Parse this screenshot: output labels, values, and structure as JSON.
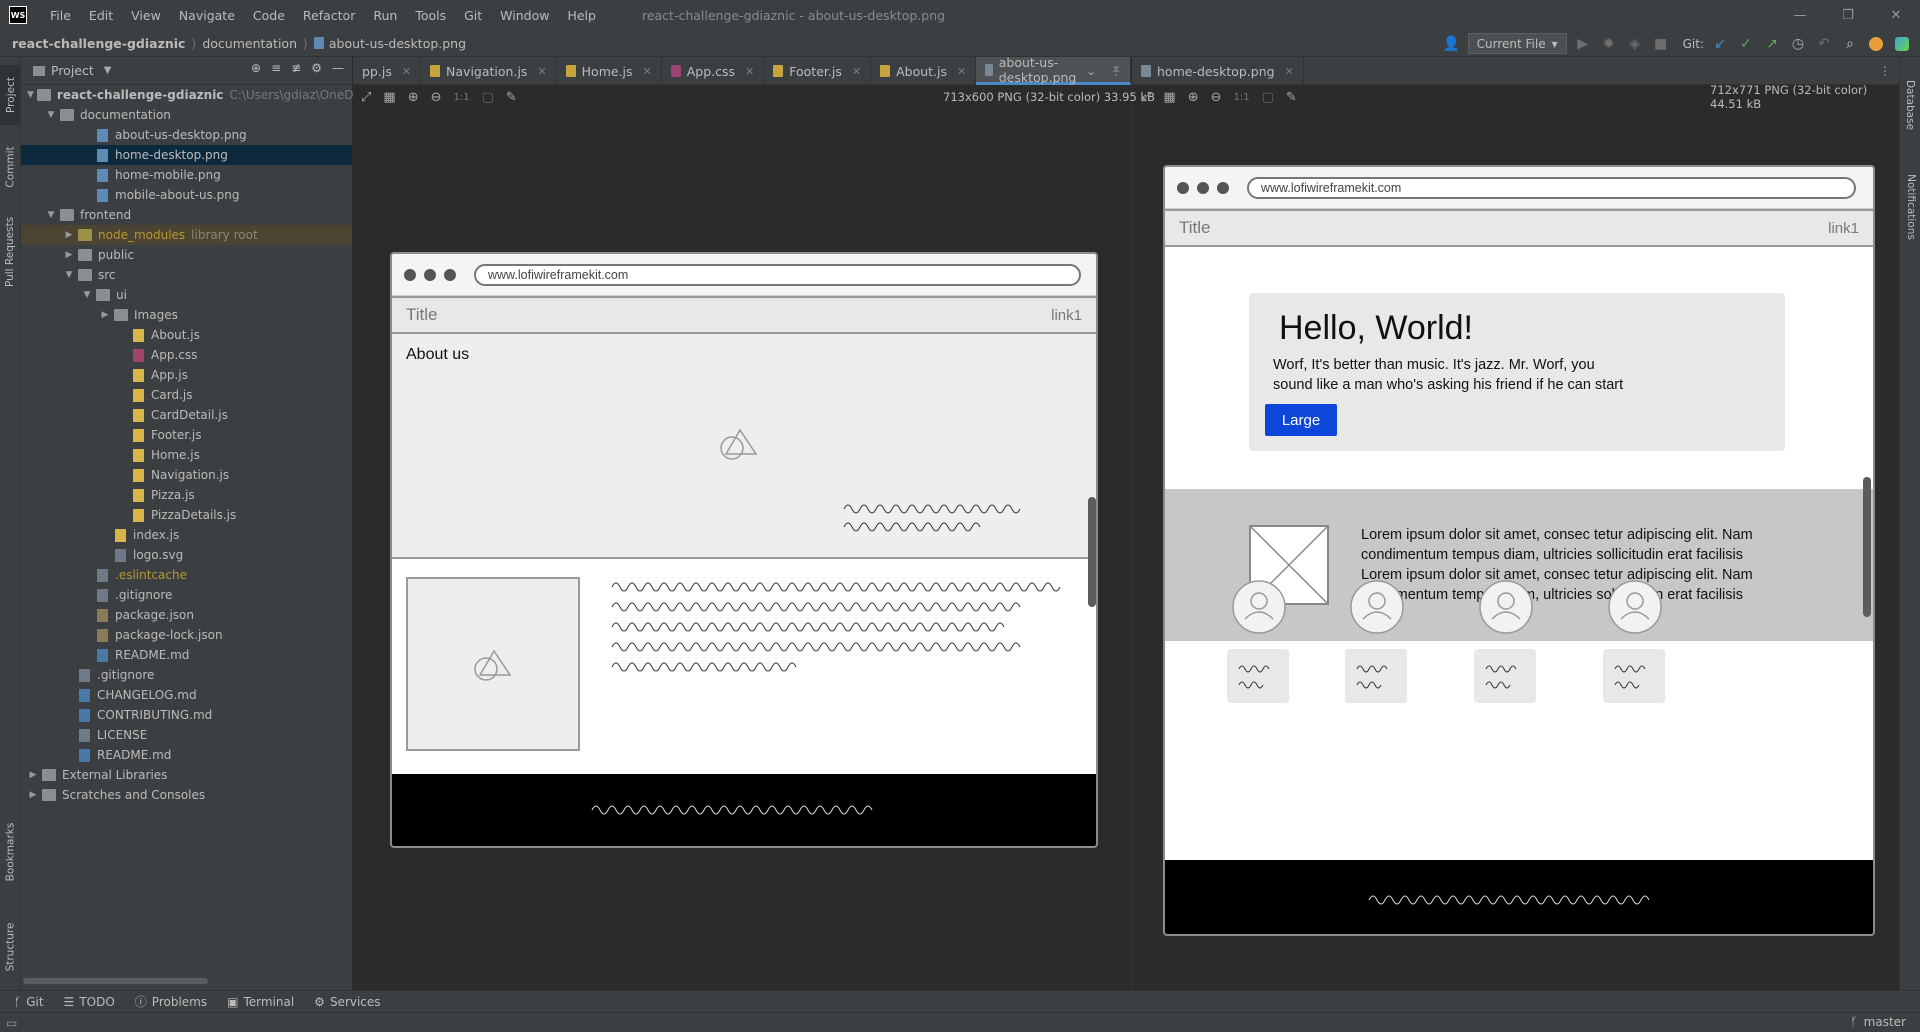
{
  "window": {
    "title": "react-challenge-gdiaznic - about-us-desktop.png",
    "menu": [
      "File",
      "Edit",
      "View",
      "Navigate",
      "Code",
      "Refactor",
      "Run",
      "Tools",
      "Git",
      "Window",
      "Help"
    ]
  },
  "breadcrumb": [
    "react-challenge-gdiaznic",
    "documentation",
    "about-us-desktop.png"
  ],
  "toolbar": {
    "run_config": "Current File",
    "git_label": "Git:"
  },
  "left_strip": [
    "Project",
    "Commit",
    "Pull Requests",
    "Bookmarks",
    "Structure"
  ],
  "right_strip": [
    "Database",
    "Notifications"
  ],
  "project": {
    "header": "Project",
    "tree": [
      {
        "label": "react-challenge-gdiaznic",
        "hint": "C:\\Users\\gdiaz\\OneDrive\\D",
        "indent": 0,
        "kind": "folder",
        "arrow": "down",
        "bold": true
      },
      {
        "label": "documentation",
        "indent": 1,
        "kind": "folder",
        "arrow": "down"
      },
      {
        "label": "about-us-desktop.png",
        "indent": 3,
        "kind": "img"
      },
      {
        "label": "home-desktop.png",
        "indent": 3,
        "kind": "img",
        "selected": true
      },
      {
        "label": "home-mobile.png",
        "indent": 3,
        "kind": "img"
      },
      {
        "label": "mobile-about-us.png",
        "indent": 3,
        "kind": "img"
      },
      {
        "label": "frontend",
        "indent": 1,
        "kind": "folder",
        "arrow": "down"
      },
      {
        "label": "node_modules",
        "hint": "library root",
        "indent": 2,
        "kind": "folder-y",
        "arrow": "right",
        "lib": true
      },
      {
        "label": "public",
        "indent": 2,
        "kind": "folder",
        "arrow": "right"
      },
      {
        "label": "src",
        "indent": 2,
        "kind": "folder",
        "arrow": "down"
      },
      {
        "label": "ui",
        "indent": 3,
        "kind": "folder",
        "arrow": "down"
      },
      {
        "label": "Images",
        "indent": 4,
        "kind": "folder",
        "arrow": "right"
      },
      {
        "label": "About.js",
        "indent": 5,
        "kind": "js"
      },
      {
        "label": "App.css",
        "indent": 5,
        "kind": "css"
      },
      {
        "label": "App.js",
        "indent": 5,
        "kind": "js"
      },
      {
        "label": "Card.js",
        "indent": 5,
        "kind": "js"
      },
      {
        "label": "CardDetail.js",
        "indent": 5,
        "kind": "js"
      },
      {
        "label": "Footer.js",
        "indent": 5,
        "kind": "js"
      },
      {
        "label": "Home.js",
        "indent": 5,
        "kind": "js"
      },
      {
        "label": "Navigation.js",
        "indent": 5,
        "kind": "js"
      },
      {
        "label": "Pizza.js",
        "indent": 5,
        "kind": "js"
      },
      {
        "label": "PizzaDetails.js",
        "indent": 5,
        "kind": "js"
      },
      {
        "label": "index.js",
        "indent": 4,
        "kind": "js"
      },
      {
        "label": "logo.svg",
        "indent": 4,
        "kind": "file"
      },
      {
        "label": ".eslintcache",
        "indent": 3,
        "kind": "file",
        "yellow": true
      },
      {
        "label": ".gitignore",
        "indent": 3,
        "kind": "file"
      },
      {
        "label": "package.json",
        "indent": 3,
        "kind": "json"
      },
      {
        "label": "package-lock.json",
        "indent": 3,
        "kind": "json"
      },
      {
        "label": "README.md",
        "indent": 3,
        "kind": "md"
      },
      {
        "label": ".gitignore",
        "indent": 2,
        "kind": "file"
      },
      {
        "label": "CHANGELOG.md",
        "indent": 2,
        "kind": "md"
      },
      {
        "label": "CONTRIBUTING.md",
        "indent": 2,
        "kind": "md"
      },
      {
        "label": "LICENSE",
        "indent": 2,
        "kind": "file"
      },
      {
        "label": "README.md",
        "indent": 2,
        "kind": "md"
      },
      {
        "label": "External Libraries",
        "indent": 0,
        "kind": "lib",
        "arrow": "right"
      },
      {
        "label": "Scratches and Consoles",
        "indent": 0,
        "kind": "scratch",
        "arrow": "right"
      }
    ]
  },
  "tabs": {
    "left": [
      {
        "label": "pp.js",
        "kind": "js"
      },
      {
        "label": "Navigation.js",
        "kind": "js"
      },
      {
        "label": "Home.js",
        "kind": "js"
      },
      {
        "label": "App.css",
        "kind": "css"
      },
      {
        "label": "Footer.js",
        "kind": "js"
      },
      {
        "label": "About.js",
        "kind": "js"
      },
      {
        "label": "about-us-desktop.png",
        "kind": "img",
        "active": true
      }
    ],
    "right": [
      {
        "label": "home-desktop.png",
        "kind": "img"
      }
    ]
  },
  "left_pane": {
    "image_info": "713x600 PNG (32-bit color) 33.95 kB",
    "mock": {
      "url": "www.lofiwireframekit.com",
      "nav_title": "Title",
      "nav_link": "link1",
      "heading": "About us"
    }
  },
  "right_pane": {
    "image_info": "712x771 PNG (32-bit color) 44.51 kB",
    "mock": {
      "url": "www.lofiwireframekit.com",
      "nav_title": "Title",
      "nav_link": "link1",
      "hero_title": "Hello, World!",
      "hero_text_1": "Worf, It's better than music. It's jazz. Mr. Worf, you",
      "hero_text_2": "sound like a man who's asking his friend if he can start",
      "hero_button": "Large",
      "lorem_1": "Lorem ipsum dolor sit amet, consec tetur adipiscing elit. Nam",
      "lorem_2": "condimentum tempus diam, ultricies sollicitudin erat facilisis",
      "lorem_3": "Lorem ipsum dolor sit amet, consec tetur adipiscing elit. Nam",
      "lorem_4": "condimentum tempus diam, ultricies sollicitudin erat facilisis"
    }
  },
  "statusbar": {
    "tools": [
      "Git",
      "TODO",
      "Problems",
      "Terminal",
      "Services"
    ],
    "branch": "master"
  },
  "colors": {
    "accent": "#4a88c7",
    "button_blue": "#0d47d9",
    "ide_bg": "#2b2b2b",
    "panel_bg": "#3c3f41"
  }
}
